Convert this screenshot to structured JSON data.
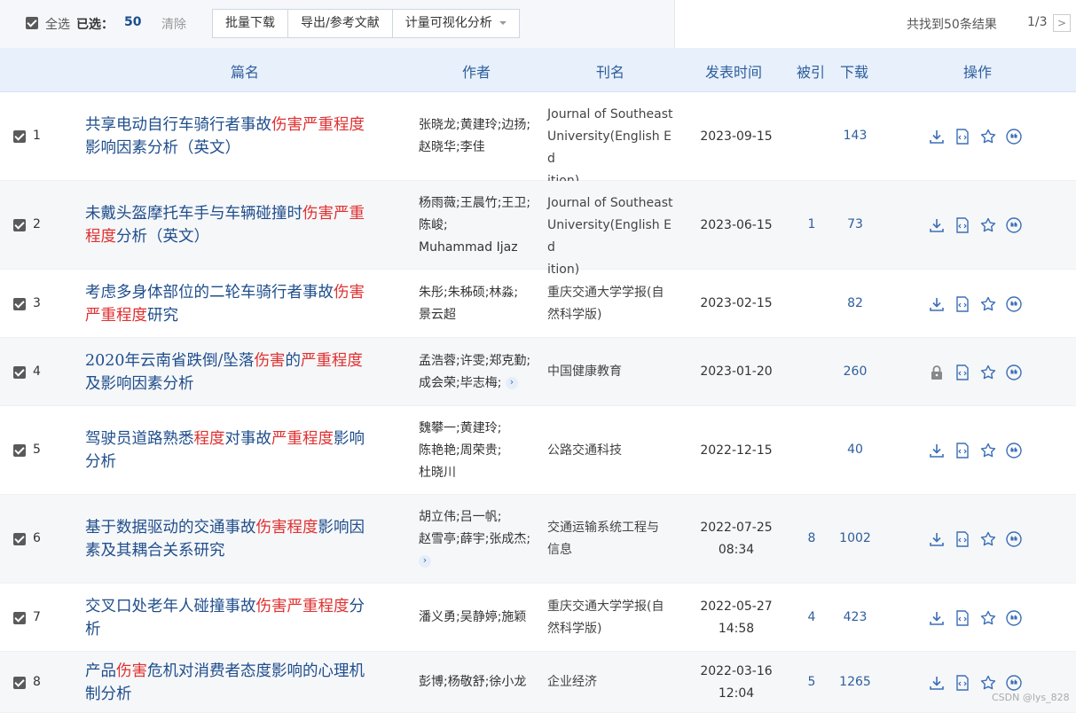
{
  "toolbar": {
    "select_all_label": "全选",
    "selected_label": "已选：",
    "selected_count": "50",
    "clear_label": "清除",
    "batch_download_label": "批量下载",
    "export_label": "导出/参考文献",
    "viz_label": "计量可视化分析",
    "result_text": "共找到50条结果",
    "page_text": "1/3",
    "next_label": ">"
  },
  "columns": {
    "title": "篇名",
    "author": "作者",
    "journal": "刊名",
    "date": "发表时间",
    "cited": "被引",
    "downloads": "下载",
    "ops": "操作"
  },
  "rows": [
    {
      "num": "1",
      "title_lines": [
        [
          {
            "t": "共享电动自行车骑行者事故",
            "h": false
          },
          {
            "t": "伤害严重程度",
            "h": true
          }
        ],
        [
          {
            "t": "影响因素分析（英文）",
            "h": false
          }
        ]
      ],
      "authors": [
        "张晓龙;黄建玲;边扬;",
        "赵晓华;李佳"
      ],
      "journal": [
        "Journal of Southeast",
        "University(English Ed",
        "ition)"
      ],
      "date": [
        "2023-09-15"
      ],
      "cited": "",
      "downloads": "143",
      "locked": false
    },
    {
      "num": "2",
      "title_lines": [
        [
          {
            "t": "未戴头盔摩托车手与车辆碰撞时",
            "h": false
          },
          {
            "t": "伤害严重",
            "h": true
          }
        ],
        [
          {
            "t": "程度",
            "h": true
          },
          {
            "t": "分析（英文）",
            "h": false
          }
        ]
      ],
      "authors": [
        "杨雨薇;王晨竹;王卫;",
        "陈峻;",
        "Muhammad Ijaz"
      ],
      "journal": [
        "Journal of Southeast",
        "University(English Ed",
        "ition)"
      ],
      "date": [
        "2023-06-15"
      ],
      "cited": "1",
      "downloads": "73",
      "locked": false
    },
    {
      "num": "3",
      "title_lines": [
        [
          {
            "t": "考虑多身体部位的二轮车骑行者事故",
            "h": false
          },
          {
            "t": "伤害",
            "h": true
          }
        ],
        [
          {
            "t": "严重程度",
            "h": true
          },
          {
            "t": "研究",
            "h": false
          }
        ]
      ],
      "authors": [
        "朱彤;朱秭硕;林淼;",
        "景云超"
      ],
      "journal": [
        "重庆交通大学学报(自",
        "然科学版)"
      ],
      "date": [
        "2023-02-15"
      ],
      "cited": "",
      "downloads": "82",
      "locked": false
    },
    {
      "num": "4",
      "title_lines": [
        [
          {
            "t": "2020年云南省跌倒/坠落",
            "h": false
          },
          {
            "t": "伤害",
            "h": true
          },
          {
            "t": "的",
            "h": false
          },
          {
            "t": "严重程度",
            "h": true
          }
        ],
        [
          {
            "t": "及影响因素分析",
            "h": false
          }
        ]
      ],
      "authors": [
        "孟浩蓉;许雯;郑克勤;",
        "成会荣;毕志梅;"
      ],
      "authors_more": true,
      "journal": [
        "中国健康教育"
      ],
      "date": [
        "2023-01-20"
      ],
      "cited": "",
      "downloads": "260",
      "locked": true
    },
    {
      "num": "5",
      "title_lines": [
        [
          {
            "t": "驾驶员道路熟悉",
            "h": false
          },
          {
            "t": "程度",
            "h": true
          },
          {
            "t": "对事故",
            "h": false
          },
          {
            "t": "严重程度",
            "h": true
          },
          {
            "t": "影响",
            "h": false
          }
        ],
        [
          {
            "t": "分析",
            "h": false
          }
        ]
      ],
      "authors": [
        "魏攀一;黄建玲;",
        "陈艳艳;周荣贵;",
        "杜晓川"
      ],
      "journal": [
        "公路交通科技"
      ],
      "date": [
        "2022-12-15"
      ],
      "cited": "",
      "downloads": "40",
      "locked": false
    },
    {
      "num": "6",
      "title_lines": [
        [
          {
            "t": "基于数据驱动的交通事故",
            "h": false
          },
          {
            "t": "伤害程度",
            "h": true
          },
          {
            "t": "影响因",
            "h": false
          }
        ],
        [
          {
            "t": "素及其耦合关系研究",
            "h": false
          }
        ]
      ],
      "authors": [
        "胡立伟;吕一帆;",
        "赵雪亭;薛宇;张成杰;"
      ],
      "authors_more": true,
      "journal": [
        "交通运输系统工程与",
        "信息"
      ],
      "date": [
        "2022-07-25",
        "08:34"
      ],
      "cited": "8",
      "downloads": "1002",
      "locked": false
    },
    {
      "num": "7",
      "title_lines": [
        [
          {
            "t": "交叉口处老年人碰撞事故",
            "h": false
          },
          {
            "t": "伤害严重程度",
            "h": true
          },
          {
            "t": "分",
            "h": false
          }
        ],
        [
          {
            "t": "析",
            "h": false
          }
        ]
      ],
      "authors": [
        "潘义勇;吴静婷;施颖"
      ],
      "journal": [
        "重庆交通大学学报(自",
        "然科学版)"
      ],
      "date": [
        "2022-05-27",
        "14:58"
      ],
      "cited": "4",
      "downloads": "423",
      "locked": false
    },
    {
      "num": "8",
      "title_lines": [
        [
          {
            "t": "产品",
            "h": false
          },
          {
            "t": "伤害",
            "h": true
          },
          {
            "t": "危机对消费者态度影响的心理机",
            "h": false
          }
        ],
        [
          {
            "t": "制分析",
            "h": false
          }
        ]
      ],
      "authors": [
        "彭博;杨敬舒;徐小龙"
      ],
      "journal": [
        "企业经济"
      ],
      "date": [
        "2022-03-16",
        "12:04"
      ],
      "cited": "5",
      "downloads": "1265",
      "locked": false
    }
  ],
  "watermark": "CSDN @lys_828",
  "colors": {
    "title_link": "#1f4e8c",
    "highlight": "#e03131",
    "header_bg": "#e8f0fb",
    "icon_blue": "#3b6fb6"
  }
}
